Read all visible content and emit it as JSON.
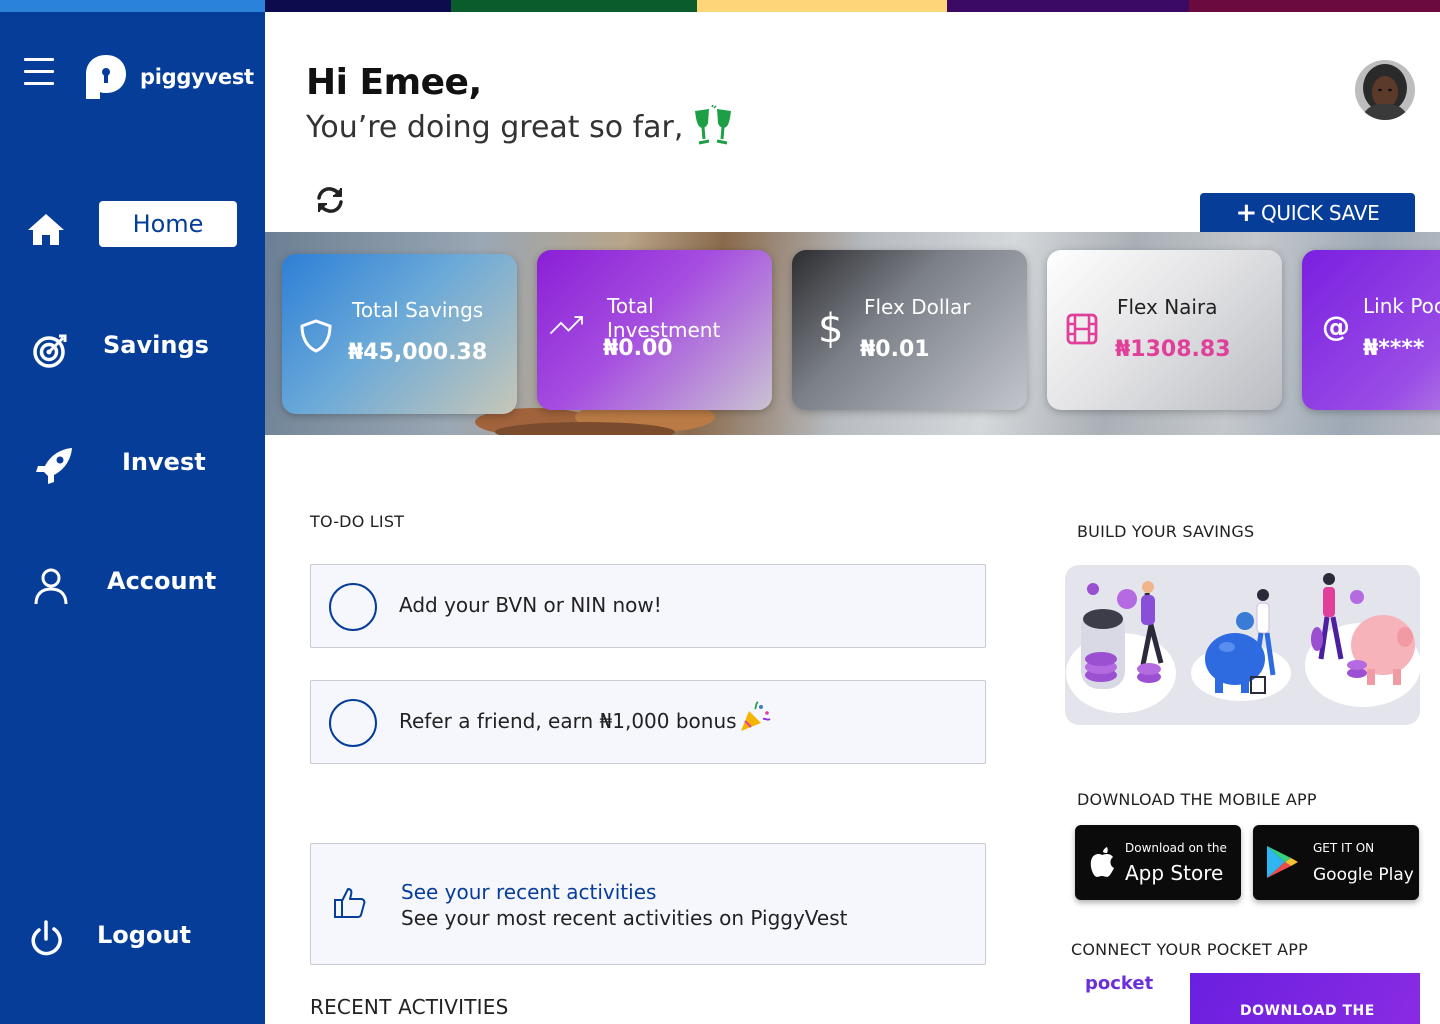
{
  "colors": {
    "brand_blue": "#063d99",
    "strip": [
      "#2a82d9",
      "#0b0b4e",
      "#0b5c2d",
      "#ffd57a",
      "#3b0a64",
      "#6b0a3e"
    ]
  },
  "sidebar": {
    "brand": "piggyvest",
    "items": [
      {
        "label": "Home",
        "icon": "home-icon",
        "active": true
      },
      {
        "label": "Savings",
        "icon": "target-icon"
      },
      {
        "label": "Invest",
        "icon": "rocket-icon"
      },
      {
        "label": "Account",
        "icon": "user-icon"
      }
    ],
    "logout": {
      "label": "Logout",
      "icon": "power-icon"
    }
  },
  "header": {
    "greeting": "Hi Emee,",
    "subtitle": "You’re doing great so far,",
    "quick_save": "QUICK SAVE"
  },
  "cards": [
    {
      "title": "Total Savings",
      "value": "₦45,000.38",
      "icon": "shield-icon"
    },
    {
      "title": "Total Investment",
      "value": "₦0.00",
      "icon": "trend-up-icon"
    },
    {
      "title": "Flex Dollar",
      "value": "₦0.01",
      "icon": "dollar-icon"
    },
    {
      "title": "Flex Naira",
      "value": "₦1308.83",
      "icon": "film-icon",
      "value_color": "#e0409a"
    },
    {
      "title": "Link Poc",
      "value": "₦****",
      "icon": "at-icon"
    }
  ],
  "todo": {
    "title": "TO-DO LIST",
    "items": [
      {
        "text": "Add your BVN or NIN now!"
      },
      {
        "text": "Refer a friend, earn ₦1,000 bonus"
      }
    ]
  },
  "activity": {
    "title": "See your recent activities",
    "subtitle": "See your most recent activities on PiggyVest",
    "section": "RECENT ACTIVITIES"
  },
  "right": {
    "build_title": "BUILD YOUR SAVINGS",
    "download_title": "DOWNLOAD THE MOBILE APP",
    "app_store": {
      "small": "Download on the",
      "big": "App Store"
    },
    "google_play": {
      "small": "GET IT ON",
      "big": "Google Play"
    },
    "pocket_title": "CONNECT YOUR POCKET APP",
    "pocket_logo": "pocket",
    "pocket_banner": "DOWNLOAD THE"
  }
}
